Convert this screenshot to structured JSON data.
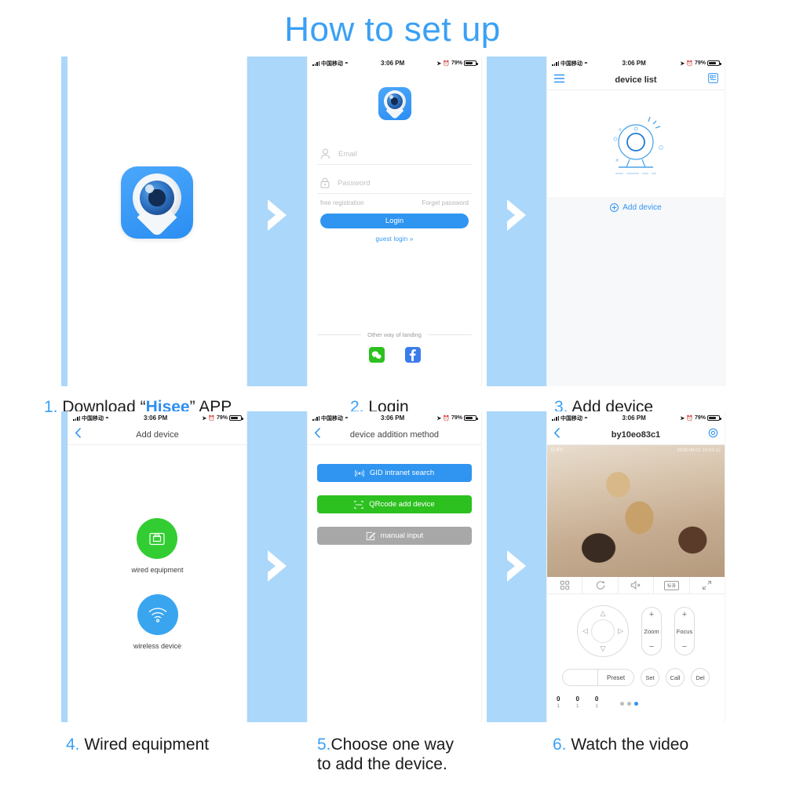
{
  "title": "How to set up",
  "status_bar": {
    "carrier": "中国移动",
    "time": "3:06 PM",
    "battery_pct": "79%"
  },
  "steps": [
    {
      "num": "1.",
      "text_before": " Download “",
      "highlight": "Hisee",
      "text_after": "” APP"
    },
    {
      "num": "2.",
      "text": " Login"
    },
    {
      "num": "3.",
      "text": " Add device"
    },
    {
      "num": "4.",
      "text": " Wired equipment"
    },
    {
      "num": "5.",
      "text": "Choose one way\nto add the device."
    },
    {
      "num": "6.",
      "text": " Watch the video"
    }
  ],
  "panel1": {
    "icon_name": "hisee-app-icon"
  },
  "panel2": {
    "email_placeholder": "Email",
    "password_placeholder": "Password",
    "free_registration": "free registration",
    "forget_password": "Forget password",
    "login_button": "Login",
    "guest_login": "guest login »",
    "other_way": "Other way of landing",
    "socials": [
      "wechat-icon",
      "facebook-icon"
    ]
  },
  "panel3": {
    "nav_title": "device list",
    "menu_icon": "hamburger-menu-icon",
    "scan_icon": "qr-scan-icon",
    "illustration": "webcam-illustration",
    "add_device": "Add device"
  },
  "panel4": {
    "nav_title": "Add device",
    "back_icon": "back-chevron-icon",
    "choices": [
      {
        "label": "wired equipment",
        "icon": "lan-port-icon",
        "color": "#32cd32"
      },
      {
        "label": "wireless device",
        "icon": "wifi-icon",
        "color": "#3aa5ef"
      }
    ]
  },
  "panel5": {
    "nav_title": "device addition method",
    "back_icon": "back-chevron-icon",
    "buttons": [
      {
        "label": "GID intranet search",
        "icon": "signal-icon",
        "color": "#2f95f0"
      },
      {
        "label": "QRcode add device",
        "icon": "qrcode-icon",
        "color": "#2cc11f"
      },
      {
        "label": "manual input",
        "icon": "pencil-square-icon",
        "color": "#a8a8a8"
      }
    ]
  },
  "panel6": {
    "nav_title": "by10eo83c1",
    "back_icon": "back-chevron-icon",
    "settings_icon": "gear-icon",
    "video_overlay_left": "D-IPC",
    "video_overlay_right": "2018-08-01 16:53:12",
    "toolbar": [
      {
        "icon": "quad-view-icon",
        "label": ""
      },
      {
        "icon": "rotate-refresh-icon",
        "label": ""
      },
      {
        "icon": "mute-speaker-icon",
        "label": ""
      },
      {
        "icon": "resolution-badge-icon",
        "label": "标清"
      },
      {
        "icon": "fullscreen-expand-icon",
        "label": ""
      }
    ],
    "dpad_icon": "direction-pad-icon",
    "zoom_label": "Zoom",
    "focus_label": "Focus",
    "plus": "+",
    "minus": "−",
    "preset_label": "Preset",
    "preset_value": "",
    "set_label": "Set",
    "call_label": "Call",
    "del_label": "Del",
    "counters": [
      {
        "top": "0",
        "bottom": "1"
      },
      {
        "top": "0",
        "bottom": "1"
      },
      {
        "top": "0",
        "bottom": "1"
      }
    ],
    "page_dots": 3,
    "active_dot": 3
  },
  "colors": {
    "accent": "#3aa0f5",
    "band": "#abd7fa",
    "green": "#2cc11f",
    "gray": "#a8a8a8"
  }
}
